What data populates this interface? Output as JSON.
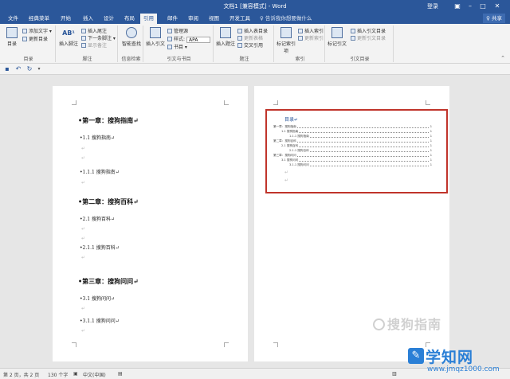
{
  "title_bar": {
    "document_title": "文档1 [兼容模式] - Word",
    "login": "登录",
    "controls": [
      "restore-icon",
      "minimize-icon",
      "maximize-icon",
      "close-icon"
    ]
  },
  "tabs": [
    "文件",
    "经典菜单",
    "开始",
    "插入",
    "设计",
    "布局",
    "引用",
    "邮件",
    "审阅",
    "视图",
    "开发工具"
  ],
  "active_tab": "引用",
  "tell_me": "♀ 告诉我你想要做什么",
  "share": "♀ 共享",
  "ribbon": {
    "toc_group": {
      "label": "目录",
      "big": "目录",
      "add_text": "添加文字 ▾",
      "update_toc": "更新目录"
    },
    "footnote_group": {
      "label": "脚注",
      "big": "插入脚注",
      "ab": "AB¹",
      "insert_endnote": "插入尾注",
      "next_footnote": "下一条脚注 ▾",
      "show_notes": "显示备注"
    },
    "research_group": {
      "label": "信息检索",
      "big": "智能查找"
    },
    "citation_group": {
      "label": "引文与书目",
      "big": "插入引文",
      "manage": "管理源",
      "style_label": "样式:",
      "style_value": "APA",
      "bibliography": "书目 ▾"
    },
    "captions_group": {
      "label": "题注",
      "big": "插入题注",
      "insert_tof": "插入表目录",
      "update_table": "更新表格",
      "cross_ref": "交叉引用"
    },
    "index_group": {
      "label": "索引",
      "big": "标记索引项",
      "insert_index": "插入索引",
      "update_index": "更新索引"
    },
    "toa_group": {
      "label": "引文目录",
      "big": "标记引文",
      "insert_toa": "插入引文目录",
      "update_toa": "更新引文目录"
    }
  },
  "qat": [
    "save-icon",
    "undo-icon",
    "redo-icon",
    "customize-icon"
  ],
  "left_page": {
    "items": [
      {
        "level": 1,
        "text": "•第一章：搜狗指南↵"
      },
      {
        "level": 2,
        "text": "•1.1 搜狗指南↵"
      },
      {
        "level": 2,
        "text": "•1.1.1 搜狗指南↵"
      },
      {
        "level": 1,
        "text": "•第二章：搜狗百科↵"
      },
      {
        "level": 2,
        "text": "•2.1 搜狗百科↵"
      },
      {
        "level": 2,
        "text": "•2.1.1 搜狗百科↵"
      },
      {
        "level": 1,
        "text": "•第三章：搜狗问问↵"
      },
      {
        "level": 2,
        "text": "•3.1 搜狗问问↵"
      },
      {
        "level": 2,
        "text": "•3.1.1 搜狗问问↵"
      }
    ],
    "paragraph_mark": "↵"
  },
  "right_page": {
    "toc_title": "目录↵",
    "toc_lines": [
      {
        "text": "第一章：搜狗指南",
        "page": "1"
      },
      {
        "text": "1.1 搜狗指南",
        "page": "1"
      },
      {
        "text": "1.1.1 搜狗指南",
        "page": "1"
      },
      {
        "text": "第二章：搜狗百科",
        "page": "1"
      },
      {
        "text": "2.1 搜狗百科",
        "page": "1"
      },
      {
        "text": "2.1.1 搜狗百科",
        "page": "1"
      },
      {
        "text": "第三章：搜狗问问",
        "page": "1"
      },
      {
        "text": "3.1 搜狗问问",
        "page": "1"
      },
      {
        "text": "3.1.1 搜狗问问",
        "page": "1"
      }
    ],
    "highlight_color": "#c0342b"
  },
  "status_bar": {
    "page": "第 2 页，共 2 页",
    "words": "130 个字",
    "language": "中文(中国)"
  },
  "watermarks": {
    "sogou": "搜狗指南",
    "site_name": "学知网",
    "site_url": "www.jmqz1000.com"
  },
  "colors": {
    "brand": "#2b579a",
    "toc_border": "#c0342b",
    "site_blue": "#2a7fd6"
  }
}
